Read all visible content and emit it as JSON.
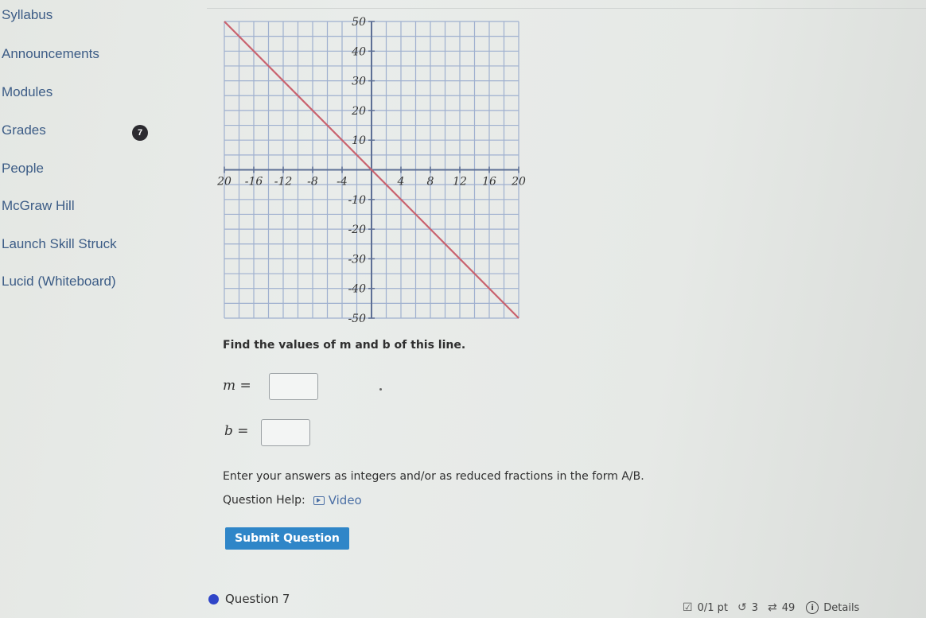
{
  "sidebar": {
    "items": [
      {
        "label": "Syllabus"
      },
      {
        "label": "Announcements"
      },
      {
        "label": "Modules"
      },
      {
        "label": "Grades",
        "badge": "7"
      },
      {
        "label": "People"
      },
      {
        "label": "McGraw Hill"
      },
      {
        "label": "Launch Skill Struck"
      },
      {
        "label": "Lucid (Whiteboard)"
      }
    ]
  },
  "chart_data": {
    "type": "line",
    "title": "",
    "xlabel": "",
    "ylabel": "",
    "xlim": [
      -20,
      20
    ],
    "ylim": [
      -50,
      50
    ],
    "x_ticks": [
      -20,
      -16,
      -12,
      -8,
      -4,
      4,
      8,
      12,
      16,
      20
    ],
    "x_tick_labels": [
      "20",
      "-16",
      "-12",
      "-8",
      "-4",
      "4",
      "8",
      "12",
      "16",
      "20"
    ],
    "y_ticks": [
      50,
      40,
      30,
      20,
      10,
      -10,
      -20,
      -30,
      -40,
      -50
    ],
    "y_tick_labels": [
      "50",
      "40",
      "30",
      "20",
      "10",
      "-10",
      "-20",
      "-30",
      "-40",
      "-50"
    ],
    "grid": true,
    "grid_step_x": 2,
    "grid_step_y": 5,
    "series": [
      {
        "name": "line",
        "color": "#c9626e",
        "x": [
          -20,
          0,
          20
        ],
        "y": [
          50,
          0,
          -50
        ]
      }
    ],
    "axis_color": "#5d6f95",
    "grid_color": "#9fb0cf"
  },
  "question": {
    "prompt": "Find the values of m and b of this line.",
    "m_label": "m =",
    "b_label": "b =",
    "m_value": "",
    "b_value": "",
    "instructions": "Enter your answers as integers and/or as reduced fractions in the form A/B.",
    "help_label": "Question Help:",
    "video_label": "Video",
    "submit_label": "Submit Question"
  },
  "next_question": {
    "label": "Question 7",
    "score": "0/1 pt",
    "retries": "3",
    "attempts": "49",
    "details_label": "Details"
  }
}
